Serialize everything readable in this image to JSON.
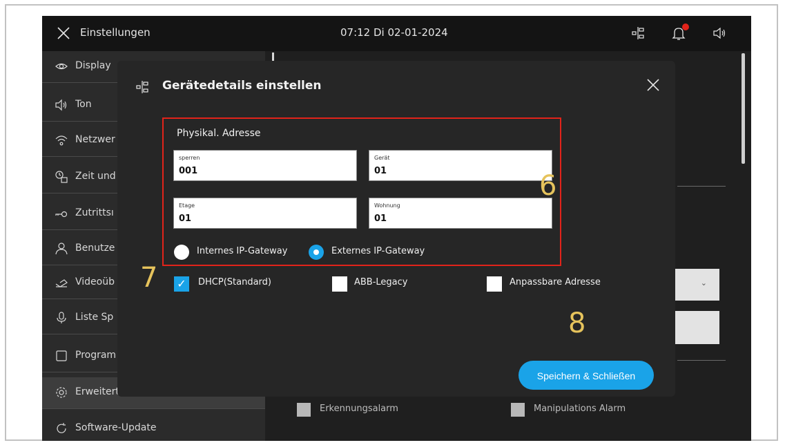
{
  "topbar": {
    "title": "Einstellungen",
    "datetime": "07:12  Di 02-01-2024"
  },
  "sidebar": {
    "items": [
      {
        "label": "Display",
        "icon": "eye-icon"
      },
      {
        "label": "Ton",
        "icon": "speaker-icon"
      },
      {
        "label": "Netzwer",
        "icon": "wifi-icon"
      },
      {
        "label": "Zeit und",
        "icon": "clock-calendar-icon"
      },
      {
        "label": "Zutrittsı",
        "icon": "key-icon"
      },
      {
        "label": "Benutze",
        "icon": "user-icon"
      },
      {
        "label": "Videoüb",
        "icon": "video-transfer-icon"
      },
      {
        "label": "Liste Sp",
        "icon": "microphone-icon"
      },
      {
        "label": "Program",
        "icon": "square-icon"
      },
      {
        "label": "Erweiterte Einstellungen",
        "icon": "gear-icon"
      },
      {
        "label": "Software-Update",
        "icon": "refresh-icon"
      }
    ]
  },
  "background": {
    "check1_label": "Erkennungsalarm",
    "check2_label": "Manipulations Alarm"
  },
  "dialog": {
    "title": "Gerätedetails einstellen",
    "box_title": "Physikal. Adresse",
    "fields": [
      {
        "label": "sperren",
        "value": "001"
      },
      {
        "label": "Gerät",
        "value": "01"
      },
      {
        "label": "Etage",
        "value": "01"
      },
      {
        "label": "Wohnung",
        "value": "01"
      }
    ],
    "radios": [
      {
        "label": "Internes IP-Gateway",
        "selected": false
      },
      {
        "label": "Externes IP-Gateway",
        "selected": true
      }
    ],
    "checkboxes": [
      {
        "label": "DHCP(Standard)",
        "checked": true
      },
      {
        "label": "ABB-Legacy",
        "checked": false
      },
      {
        "label": "Anpassbare Adresse",
        "checked": false
      }
    ],
    "save_label": "Speichern & Schließen"
  },
  "annotations": {
    "a6": "6",
    "a7": "7",
    "a8": "8"
  },
  "colors": {
    "accent": "#1aa3e8",
    "highlight_border": "#e2231a",
    "annotation": "#e6c35c"
  }
}
